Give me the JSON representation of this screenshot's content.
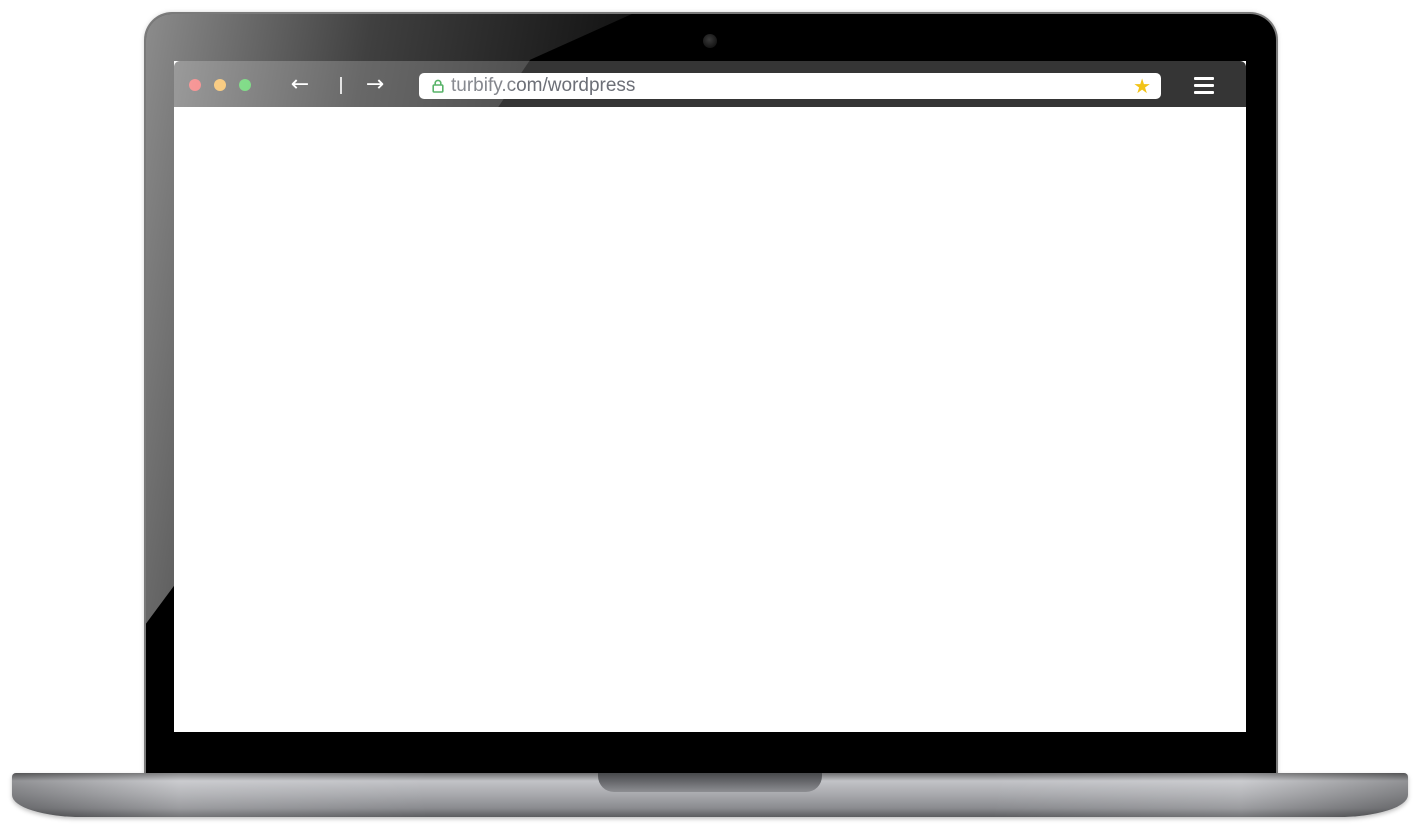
{
  "browser": {
    "window_controls": {
      "close_color": "#ee3b3b",
      "minimize_color": "#f5a524",
      "maximize_color": "#2ec43a"
    },
    "navigation": {
      "back_icon": "←",
      "forward_icon": "→"
    },
    "address_bar": {
      "url": "turbify.com/wordpress",
      "secure": true,
      "lock_color": "#2ea043",
      "bookmark_icon": "★",
      "bookmark_color": "#f2c318"
    },
    "menu_icon": "hamburger-menu-icon",
    "toolbar_color": "#353535"
  },
  "page": {
    "content": ""
  }
}
